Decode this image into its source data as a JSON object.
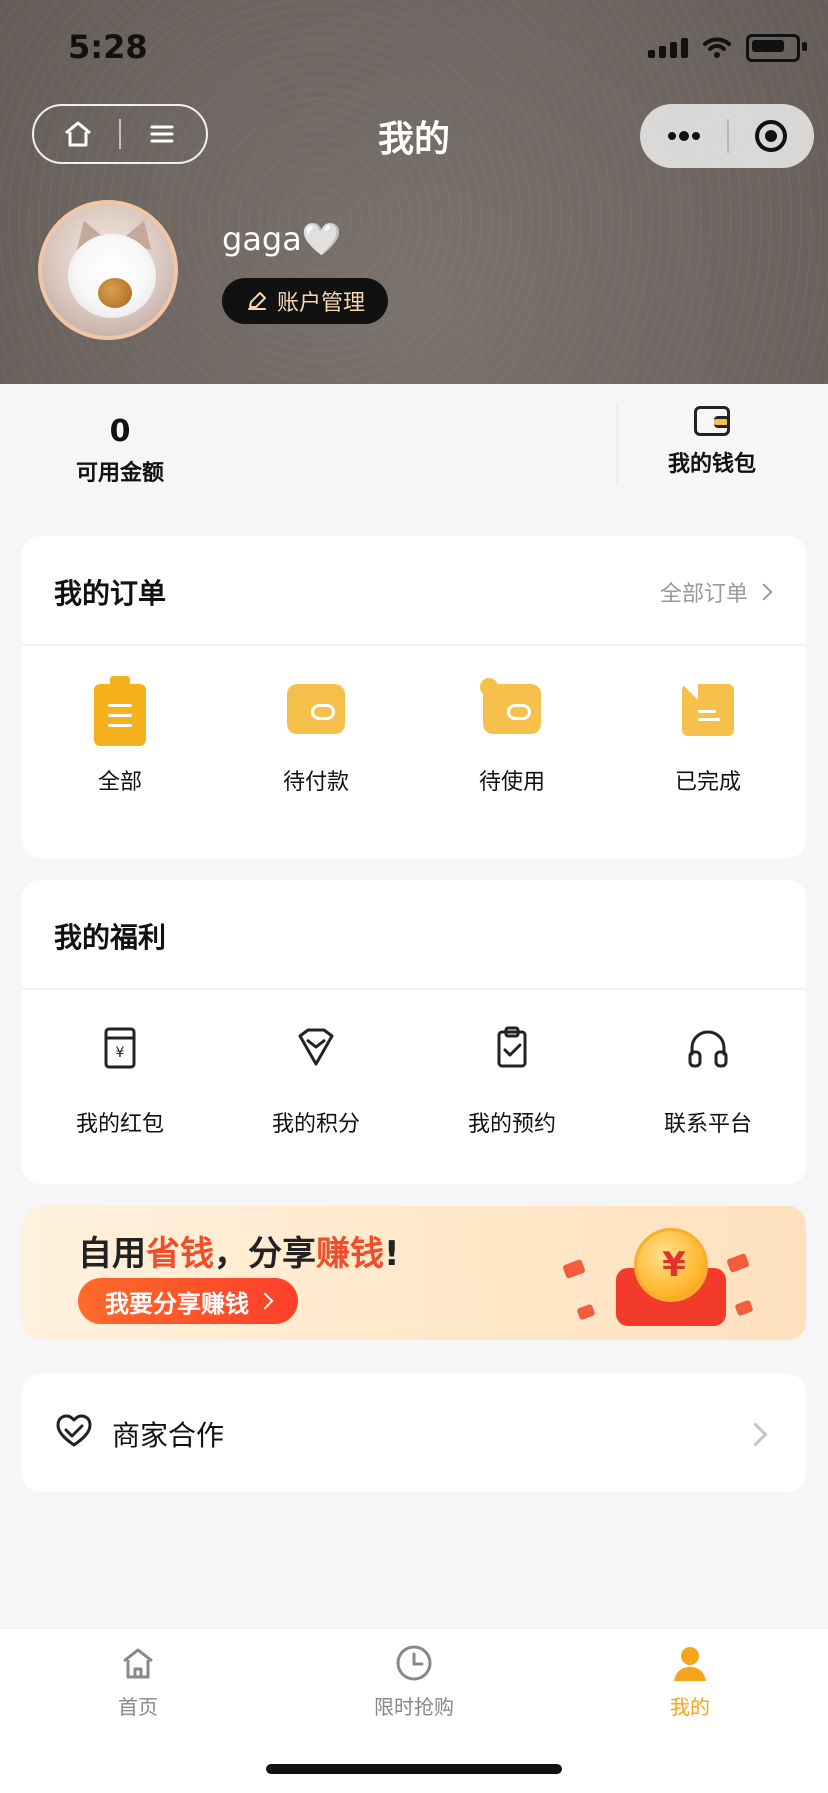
{
  "status_bar": {
    "time": "5:28"
  },
  "header": {
    "title": "我的",
    "username": "gaga🤍",
    "account_manage": "账户管理"
  },
  "balance": {
    "amount": "0",
    "amount_label": "可用金额",
    "wallet_label": "我的钱包"
  },
  "orders": {
    "title": "我的订单",
    "all_link": "全部订单",
    "items": [
      {
        "label": "全部",
        "icon": "clipboard-icon"
      },
      {
        "label": "待付款",
        "icon": "wallet-icon"
      },
      {
        "label": "待使用",
        "icon": "clock-wallet-icon"
      },
      {
        "label": "已完成",
        "icon": "document-icon"
      }
    ]
  },
  "welfare": {
    "title": "我的福利",
    "items": [
      {
        "label": "我的红包",
        "icon": "red-envelope-icon"
      },
      {
        "label": "我的积分",
        "icon": "diamond-icon"
      },
      {
        "label": "我的预约",
        "icon": "clipboard-check-icon"
      },
      {
        "label": "联系平台",
        "icon": "headset-icon"
      }
    ]
  },
  "banner": {
    "headline_prefix": "自用",
    "headline_accent1": "省钱",
    "headline_mid": "，分享",
    "headline_accent2": "赚钱",
    "headline_suffix": "!",
    "cta": "我要分享赚钱",
    "coin_symbol": "¥"
  },
  "merchant": {
    "label": "商家合作"
  },
  "tabbar": {
    "tabs": [
      {
        "label": "首页"
      },
      {
        "label": "限时抢购"
      },
      {
        "label": "我的"
      }
    ],
    "active_color": "#f6a51b"
  }
}
